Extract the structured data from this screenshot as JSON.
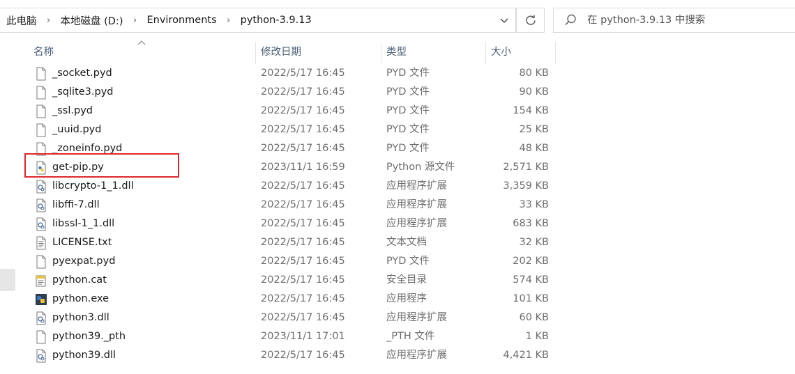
{
  "breadcrumb": [
    "此电脑",
    "本地磁盘 (D:)",
    "Environments",
    "python-3.9.13"
  ],
  "search": {
    "placeholder": "在 python-3.9.13 中搜索"
  },
  "columns": {
    "name": "名称",
    "date": "修改日期",
    "type": "类型",
    "size": "大小"
  },
  "files": [
    {
      "name": "_socket.pyd",
      "date": "2022/5/17 16:45",
      "type": "PYD 文件",
      "size": "80 KB",
      "icon": "file-icon"
    },
    {
      "name": "_sqlite3.pyd",
      "date": "2022/5/17 16:45",
      "type": "PYD 文件",
      "size": "90 KB",
      "icon": "file-icon"
    },
    {
      "name": "_ssl.pyd",
      "date": "2022/5/17 16:45",
      "type": "PYD 文件",
      "size": "154 KB",
      "icon": "file-icon"
    },
    {
      "name": "_uuid.pyd",
      "date": "2022/5/17 16:45",
      "type": "PYD 文件",
      "size": "25 KB",
      "icon": "file-icon"
    },
    {
      "name": "_zoneinfo.pyd",
      "date": "2022/5/17 16:45",
      "type": "PYD 文件",
      "size": "48 KB",
      "icon": "file-icon"
    },
    {
      "name": "get-pip.py",
      "date": "2023/11/1 16:59",
      "type": "Python 源文件",
      "size": "2,571 KB",
      "icon": "python-file-icon"
    },
    {
      "name": "libcrypto-1_1.dll",
      "date": "2022/5/17 16:45",
      "type": "应用程序扩展",
      "size": "3,359 KB",
      "icon": "dll-icon"
    },
    {
      "name": "libffi-7.dll",
      "date": "2022/5/17 16:45",
      "type": "应用程序扩展",
      "size": "33 KB",
      "icon": "dll-icon"
    },
    {
      "name": "libssl-1_1.dll",
      "date": "2022/5/17 16:45",
      "type": "应用程序扩展",
      "size": "683 KB",
      "icon": "dll-icon"
    },
    {
      "name": "LICENSE.txt",
      "date": "2022/5/17 16:45",
      "type": "文本文档",
      "size": "32 KB",
      "icon": "text-file-icon"
    },
    {
      "name": "pyexpat.pyd",
      "date": "2022/5/17 16:45",
      "type": "PYD 文件",
      "size": "202 KB",
      "icon": "file-icon"
    },
    {
      "name": "python.cat",
      "date": "2022/5/17 16:45",
      "type": "安全目录",
      "size": "574 KB",
      "icon": "security-catalog-icon"
    },
    {
      "name": "python.exe",
      "date": "2022/5/17 16:45",
      "type": "应用程序",
      "size": "101 KB",
      "icon": "python-exe-icon"
    },
    {
      "name": "python3.dll",
      "date": "2022/5/17 16:45",
      "type": "应用程序扩展",
      "size": "60 KB",
      "icon": "dll-icon"
    },
    {
      "name": "python39._pth",
      "date": "2023/11/1 17:01",
      "type": "_PTH 文件",
      "size": "1 KB",
      "icon": "file-icon"
    },
    {
      "name": "python39.dll",
      "date": "2022/5/17 16:45",
      "type": "应用程序扩展",
      "size": "4,421 KB",
      "icon": "dll-icon"
    }
  ],
  "colors": {
    "highlight_border": "#e0262b",
    "header_text": "#4c607a"
  }
}
